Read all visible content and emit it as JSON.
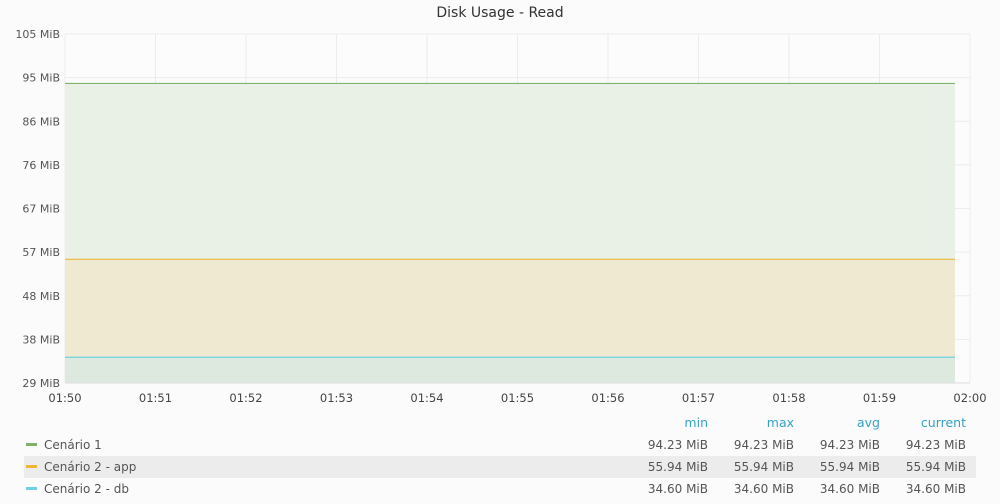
{
  "chart_data": {
    "type": "area",
    "title": "Disk Usage - Read",
    "xlabel": "",
    "ylabel": "",
    "x_ticks": [
      "01:50",
      "01:51",
      "01:52",
      "01:53",
      "01:54",
      "01:55",
      "01:56",
      "01:57",
      "01:58",
      "01:59",
      "02:00"
    ],
    "y_ticks": [
      "105 MiB",
      "95 MiB",
      "86 MiB",
      "76 MiB",
      "67 MiB",
      "57 MiB",
      "48 MiB",
      "38 MiB",
      "29 MiB"
    ],
    "ylim": [
      29,
      105
    ],
    "x_start": "01:50",
    "x_end": "01:59:50",
    "grid": true,
    "legend_position": "bottom",
    "series": [
      {
        "name": "Cenário 1",
        "values": [
          94.23,
          94.23
        ],
        "color": "#7eb26d",
        "fill": "#e9f0e6"
      },
      {
        "name": "Cenário 2 - app",
        "values": [
          55.94,
          55.94
        ],
        "color": "#eab839",
        "fill": "#eee9d0"
      },
      {
        "name": "Cenário 2 - db",
        "values": [
          34.6,
          34.6
        ],
        "color": "#6ed0e0",
        "fill": "#dde9de"
      }
    ]
  },
  "legend": {
    "headers": {
      "min": "min",
      "max": "max",
      "avg": "avg",
      "current": "current"
    },
    "rows": [
      {
        "name": "Cenário 1",
        "min": "94.23 MiB",
        "max": "94.23 MiB",
        "avg": "94.23 MiB",
        "current": "94.23 MiB",
        "color": "#7eb26d"
      },
      {
        "name": "Cenário 2 - app",
        "min": "55.94 MiB",
        "max": "55.94 MiB",
        "avg": "55.94 MiB",
        "current": "55.94 MiB",
        "color": "#eab839"
      },
      {
        "name": "Cenário 2 - db",
        "min": "34.60 MiB",
        "max": "34.60 MiB",
        "avg": "34.60 MiB",
        "current": "34.60 MiB",
        "color": "#6ed0e0"
      }
    ]
  }
}
